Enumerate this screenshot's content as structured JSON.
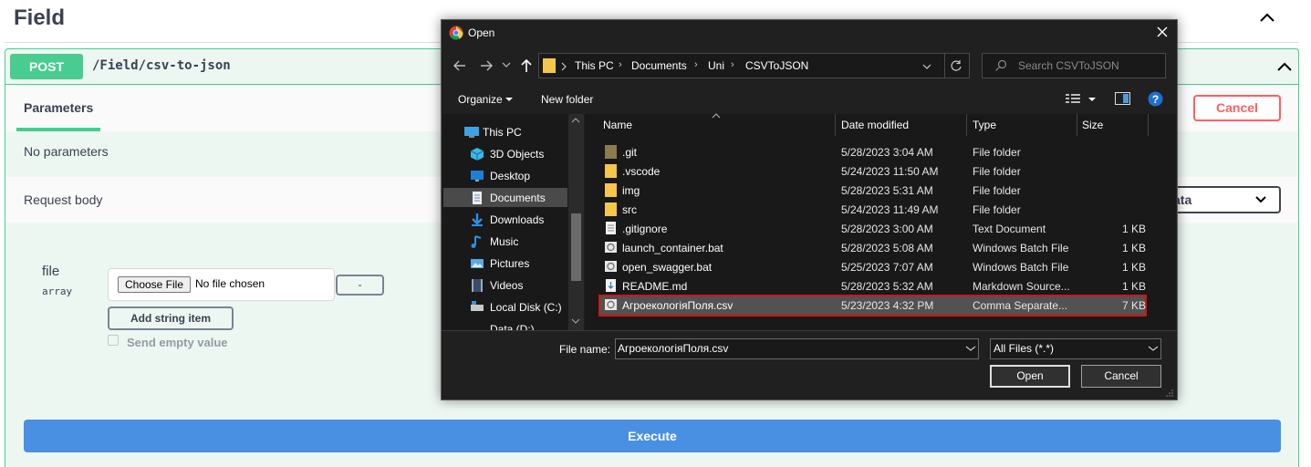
{
  "swagger": {
    "section_title": "Field",
    "method": "POST",
    "path": "/Field/csv-to-json",
    "params_tab": "Parameters",
    "cancel_label": "Cancel",
    "no_params": "No parameters",
    "request_body_label": "Request body",
    "content_type_value": "ata",
    "file_param_name": "file",
    "file_param_type": "array",
    "choose_file_label": "Choose File",
    "no_file_chosen": "No file chosen",
    "remove_item_label": "-",
    "add_item_label": "Add string item",
    "send_empty_label": "Send empty value",
    "execute_label": "Execute",
    "colors": {
      "post": "#49cc90",
      "execute": "#4990e2",
      "cancel": "#ff6060"
    }
  },
  "dialog": {
    "title": "Open",
    "breadcrumbs": [
      "This PC",
      "Documents",
      "Uni",
      "CSVToJSON"
    ],
    "search_placeholder": "Search CSVToJSON",
    "organize_label": "Organize",
    "new_folder_label": "New folder",
    "tree": [
      {
        "label": "This PC",
        "icon": "computer-icon"
      },
      {
        "label": "3D Objects",
        "icon": "cube-icon"
      },
      {
        "label": "Desktop",
        "icon": "desktop-icon"
      },
      {
        "label": "Documents",
        "icon": "document-icon",
        "selected": true
      },
      {
        "label": "Downloads",
        "icon": "download-icon"
      },
      {
        "label": "Music",
        "icon": "music-icon"
      },
      {
        "label": "Pictures",
        "icon": "picture-icon"
      },
      {
        "label": "Videos",
        "icon": "video-icon"
      },
      {
        "label": "Local Disk (C:)",
        "icon": "drive-icon"
      },
      {
        "label": "Data (D:)",
        "icon": "drive-icon"
      }
    ],
    "columns": {
      "name": "Name",
      "date": "Date modified",
      "type": "Type",
      "size": "Size"
    },
    "files": [
      {
        "name": ".git",
        "date": "5/28/2023 3:04 AM",
        "type": "File folder",
        "size": "",
        "icon": "folder-icon"
      },
      {
        "name": ".vscode",
        "date": "5/24/2023 11:50 AM",
        "type": "File folder",
        "size": "",
        "icon": "folder-icon"
      },
      {
        "name": "img",
        "date": "5/28/2023 5:31 AM",
        "type": "File folder",
        "size": "",
        "icon": "folder-icon"
      },
      {
        "name": "src",
        "date": "5/24/2023 11:49 AM",
        "type": "File folder",
        "size": "",
        "icon": "folder-icon"
      },
      {
        "name": ".gitignore",
        "date": "5/28/2023 3:00 AM",
        "type": "Text Document",
        "size": "1 KB",
        "icon": "text-file-icon"
      },
      {
        "name": "launch_container.bat",
        "date": "5/28/2023 5:08 AM",
        "type": "Windows Batch File",
        "size": "1 KB",
        "icon": "batch-file-icon"
      },
      {
        "name": "open_swagger.bat",
        "date": "5/25/2023 7:07 AM",
        "type": "Windows Batch File",
        "size": "1 KB",
        "icon": "batch-file-icon"
      },
      {
        "name": "README.md",
        "date": "5/28/2023 5:32 AM",
        "type": "Markdown Source...",
        "size": "1 KB",
        "icon": "markdown-file-icon"
      },
      {
        "name": "АгроекологіяПоля.csv",
        "date": "5/23/2023 4:32 PM",
        "type": "Comma Separate...",
        "size": "7 KB",
        "icon": "csv-file-icon",
        "selected": true
      }
    ],
    "file_name_label": "File name:",
    "file_name_value": "АгроекологіяПоля.csv",
    "filter_value": "All Files (*.*)",
    "open_label": "Open",
    "cancel_label": "Cancel"
  }
}
